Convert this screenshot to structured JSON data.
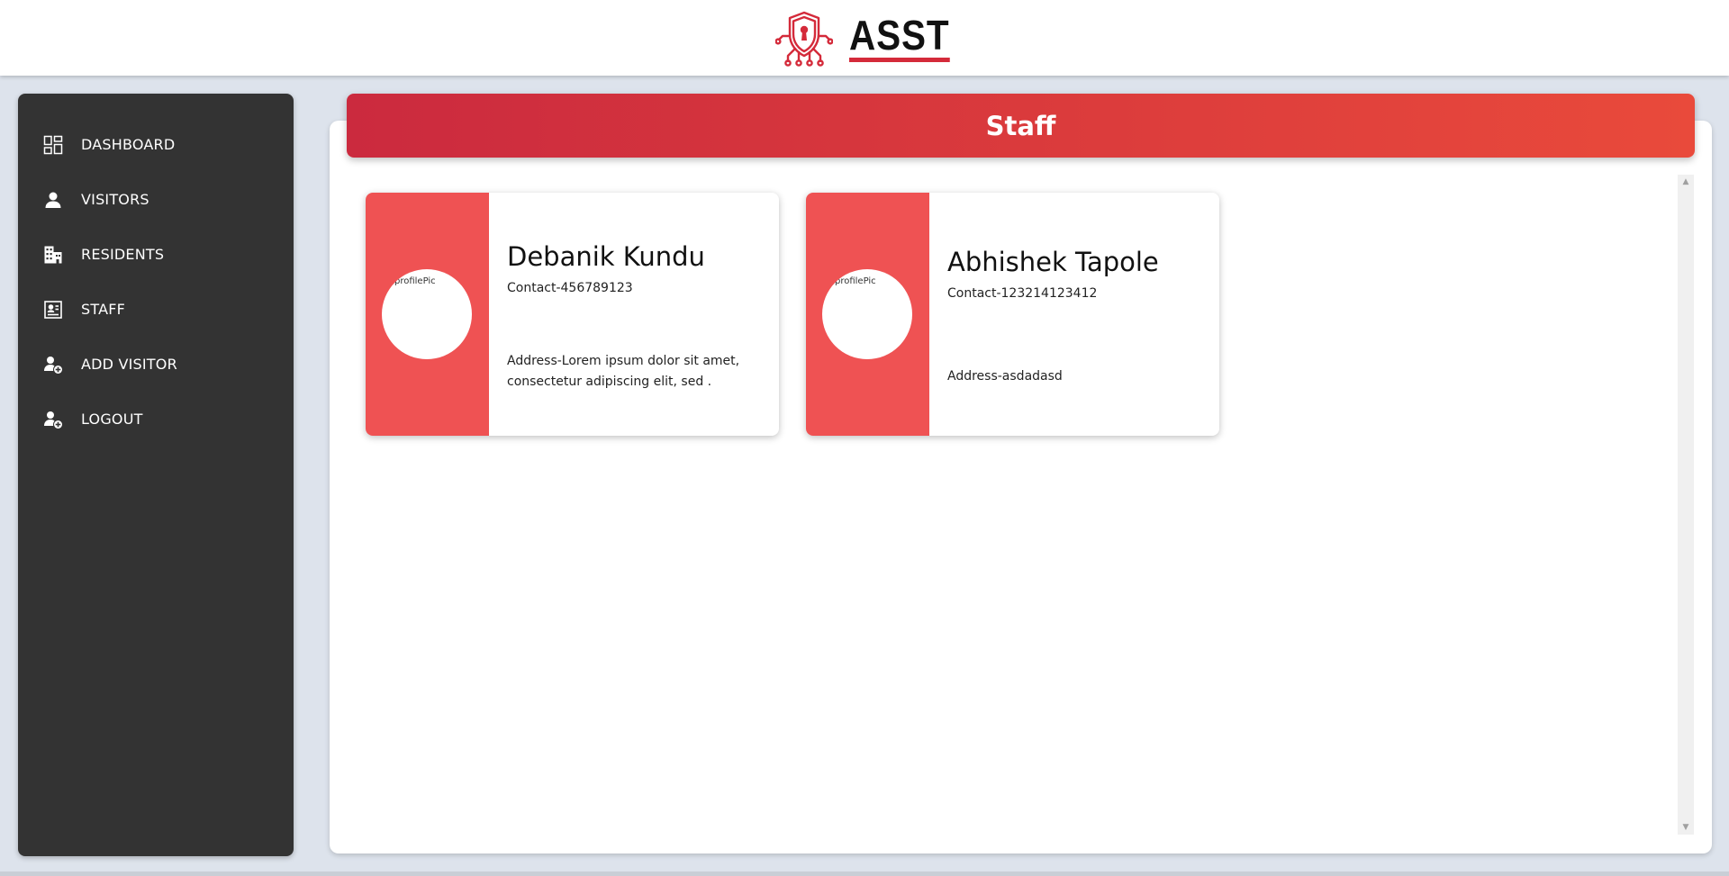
{
  "header": {
    "logo_text": "ASST",
    "logo_icon": "shield-keyhole-icon",
    "colors": {
      "brand_red": "#d42a3a"
    }
  },
  "sidebar": {
    "items": [
      {
        "label": "DASHBOARD",
        "icon": "dashboard-grid-icon"
      },
      {
        "label": "VISITORS",
        "icon": "person-icon"
      },
      {
        "label": "RESIDENTS",
        "icon": "building-icon"
      },
      {
        "label": "STAFF",
        "icon": "id-card-icon"
      },
      {
        "label": "ADD VISITOR",
        "icon": "person-add-icon"
      },
      {
        "label": "LOGOUT",
        "icon": "person-add-icon"
      }
    ]
  },
  "main": {
    "title": "Staff",
    "colors": {
      "header_start": "#cb2a3e",
      "header_end": "#e94a3b",
      "card_accent": "#ef5253"
    },
    "cards": [
      {
        "name": "Debanik Kundu",
        "contact": "Contact-456789123",
        "address": "Address-Lorem ipsum dolor sit amet, consectetur adipiscing elit, sed .",
        "avatar_alt": "profilePic"
      },
      {
        "name": "Abhishek Tapole",
        "contact": "Contact-123214123412",
        "address": "Address-asdadasd",
        "avatar_alt": "profilePic"
      }
    ]
  }
}
